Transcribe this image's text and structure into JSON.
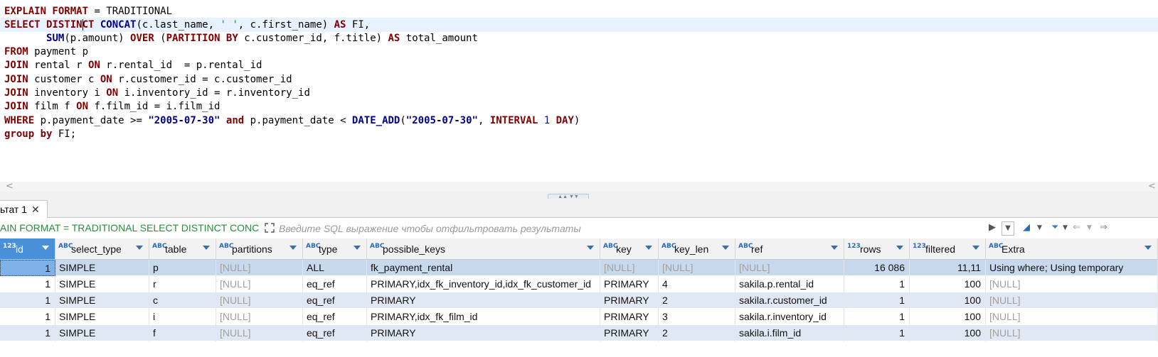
{
  "editor": {
    "lines": [
      "EXPLAIN FORMAT = TRADITIONAL",
      "SELECT DISTINCT CONCAT(c.last_name, ' ', c.first_name) AS FI,",
      "       SUM(p.amount) OVER (PARTITION BY c.customer_id, f.title) AS total_amount",
      "FROM payment p",
      "JOIN rental r ON r.rental_id  = p.rental_id",
      "JOIN customer c ON r.customer_id = c.customer_id",
      "JOIN inventory i ON i.inventory_id = r.inventory_id",
      "JOIN film f ON f.film_id = i.film_id",
      "WHERE p.payment_date >= \"2005-07-30\" and p.payment_date < DATE_ADD(\"2005-07-30\", INTERVAL 1 DAY)",
      "group by FI;"
    ]
  },
  "result_tab": {
    "label": "ьтат 1",
    "close": "✕"
  },
  "filter_bar": {
    "query_preview": "AIN FORMAT = TRADITIONAL SELECT DISTINCT CONCA",
    "placeholder": "Введите SQL выражение чтобы отфильтровать результаты"
  },
  "grid": {
    "columns": [
      {
        "name": "id",
        "type_badge": "123"
      },
      {
        "name": "select_type",
        "type_badge": "ABC"
      },
      {
        "name": "table",
        "type_badge": "ABC"
      },
      {
        "name": "partitions",
        "type_badge": "ABC"
      },
      {
        "name": "type",
        "type_badge": "ABC"
      },
      {
        "name": "possible_keys",
        "type_badge": "ABC"
      },
      {
        "name": "key",
        "type_badge": "ABC"
      },
      {
        "name": "key_len",
        "type_badge": "ABC"
      },
      {
        "name": "ref",
        "type_badge": "ABC"
      },
      {
        "name": "rows",
        "type_badge": "123"
      },
      {
        "name": "filtered",
        "type_badge": "123"
      },
      {
        "name": "Extra",
        "type_badge": "ABC"
      }
    ],
    "rows": [
      [
        "1",
        "SIMPLE",
        "p",
        "[NULL]",
        "ALL",
        "fk_payment_rental",
        "[NULL]",
        "[NULL]",
        "[NULL]",
        "16 086",
        "11,11",
        "Using where; Using temporary"
      ],
      [
        "1",
        "SIMPLE",
        "r",
        "[NULL]",
        "eq_ref",
        "PRIMARY,idx_fk_inventory_id,idx_fk_customer_id",
        "PRIMARY",
        "4",
        "sakila.p.rental_id",
        "1",
        "100",
        "[NULL]"
      ],
      [
        "1",
        "SIMPLE",
        "c",
        "[NULL]",
        "eq_ref",
        "PRIMARY",
        "PRIMARY",
        "2",
        "sakila.r.customer_id",
        "1",
        "100",
        "[NULL]"
      ],
      [
        "1",
        "SIMPLE",
        "i",
        "[NULL]",
        "eq_ref",
        "PRIMARY,idx_fk_film_id",
        "PRIMARY",
        "3",
        "sakila.r.inventory_id",
        "1",
        "100",
        "[NULL]"
      ],
      [
        "1",
        "SIMPLE",
        "f",
        "[NULL]",
        "eq_ref",
        "PRIMARY",
        "PRIMARY",
        "2",
        "sakila.i.film_id",
        "1",
        "100",
        "[NULL]"
      ]
    ]
  },
  "colors": {
    "keyword": "#7f0000",
    "function": "#000080",
    "number": "#0000ff",
    "header_selected": "#4a90d9",
    "row_alt": "#dfe8f3"
  }
}
